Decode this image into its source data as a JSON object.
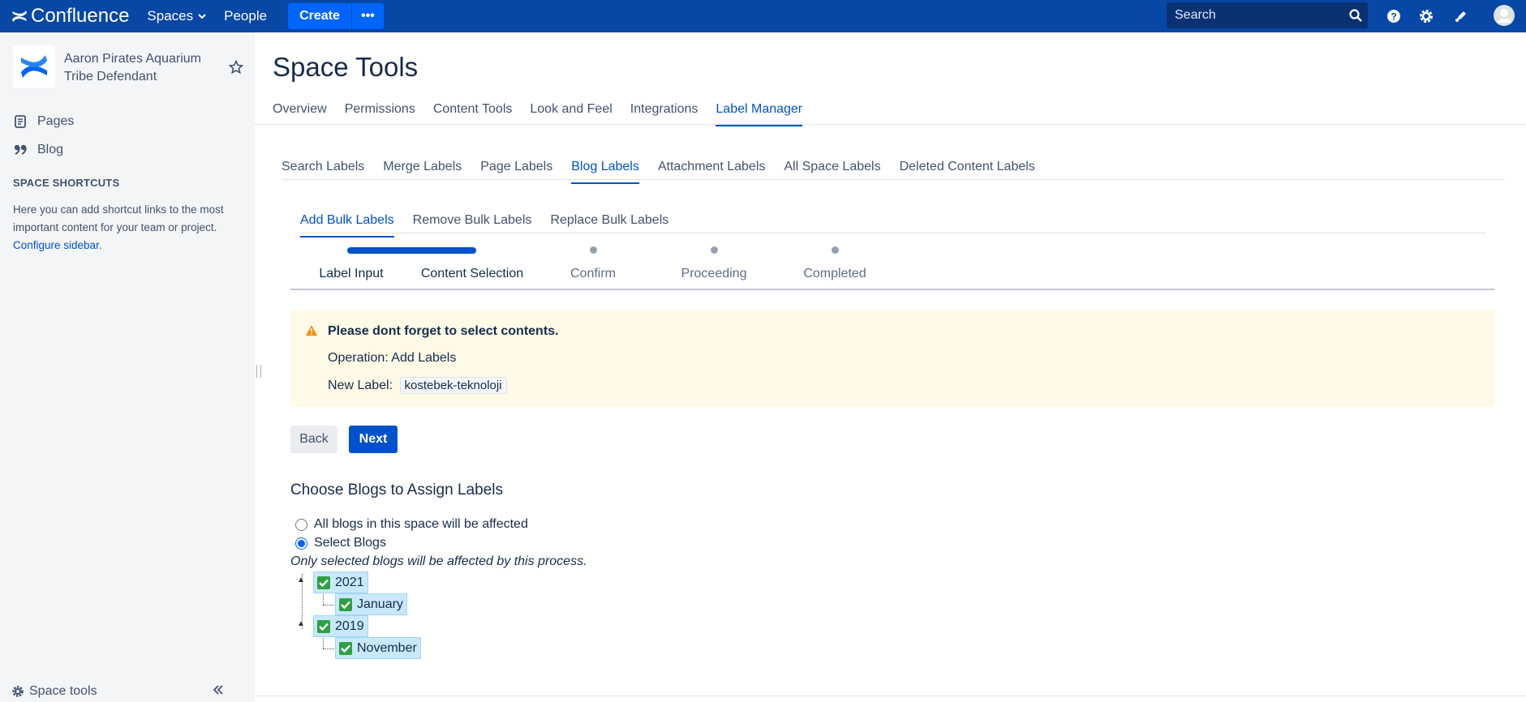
{
  "topnav": {
    "brand": "Confluence",
    "spaces": "Spaces",
    "people": "People",
    "create": "Create",
    "more": "•••",
    "search_placeholder": "Search"
  },
  "sidebar": {
    "space_name": "Aaron Pirates Aquarium Tribe Defendant",
    "pages": "Pages",
    "blog": "Blog",
    "shortcuts_title": "SPACE SHORTCUTS",
    "shortcuts_text": "Here you can add shortcut links to the most important content for your team or project.",
    "configure": "Configure sidebar",
    "space_tools": "Space tools"
  },
  "main": {
    "title": "Space Tools",
    "tabs": [
      "Overview",
      "Permissions",
      "Content Tools",
      "Look and Feel",
      "Integrations",
      "Label Manager"
    ],
    "subtabs": [
      "Search Labels",
      "Merge Labels",
      "Page Labels",
      "Blog Labels",
      "Attachment Labels",
      "All Space Labels",
      "Deleted Content Labels"
    ],
    "bulktabs": [
      "Add Bulk Labels",
      "Remove Bulk Labels",
      "Replace Bulk Labels"
    ],
    "steps": [
      "Label Input",
      "Content Selection",
      "Confirm",
      "Proceeding",
      "Completed"
    ],
    "current_step": 2,
    "warning": {
      "title": "Please dont forget to select contents.",
      "operation": "Operation: Add Labels",
      "new_label_prefix": "New Label:",
      "new_label": "kostebek-teknoloji"
    },
    "back": "Back",
    "next": "Next",
    "section_title": "Choose Blogs to Assign Labels",
    "radio_all": "All blogs in this space will be affected",
    "radio_select": "Select Blogs",
    "note": "Only selected blogs will be affected by this process.",
    "tree": {
      "y1": "2021",
      "m1": "January",
      "y2": "2019",
      "m2": "November"
    }
  },
  "colors": {
    "nav": "#0747a6",
    "primary": "#0052cc",
    "warning_bg": "#fffae6",
    "sidebar_bg": "#f4f5f7",
    "tree_bg": "#c9e8fb"
  }
}
